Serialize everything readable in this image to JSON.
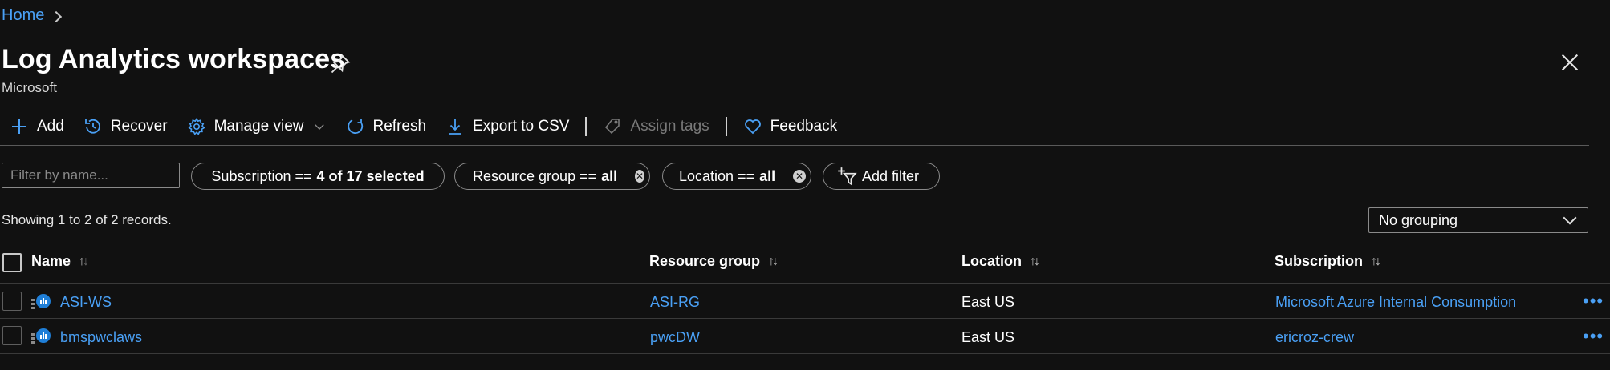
{
  "breadcrumb": {
    "home": "Home"
  },
  "header": {
    "title": "Log Analytics workspaces",
    "subtitle": "Microsoft"
  },
  "toolbar": {
    "add": "Add",
    "recover": "Recover",
    "manage_view": "Manage view",
    "refresh": "Refresh",
    "export": "Export to CSV",
    "assign_tags": "Assign tags",
    "feedback": "Feedback"
  },
  "filters": {
    "name_placeholder": "Filter by name...",
    "subscription": {
      "label": "Subscription ==",
      "value": "4 of 17 selected"
    },
    "resource_group": {
      "label": "Resource group ==",
      "value": "all"
    },
    "location": {
      "label": "Location ==",
      "value": "all"
    },
    "add_filter": "Add filter"
  },
  "records_text": "Showing 1 to 2 of 2 records.",
  "grouping": {
    "selected": "No grouping"
  },
  "table": {
    "columns": {
      "name": "Name",
      "resource_group": "Resource group",
      "location": "Location",
      "subscription": "Subscription"
    },
    "rows": [
      {
        "name": "ASI-WS",
        "resource_group": "ASI-RG",
        "location": "East US",
        "subscription": "Microsoft Azure Internal Consumption"
      },
      {
        "name": "bmspwclaws",
        "resource_group": "pwcDW",
        "location": "East US",
        "subscription": "ericroz-crew"
      }
    ]
  },
  "colors": {
    "background": "#111111",
    "link": "#4aa0f5",
    "accent_icon": "#4aa0f5",
    "disabled_text": "#7a7a7a"
  }
}
